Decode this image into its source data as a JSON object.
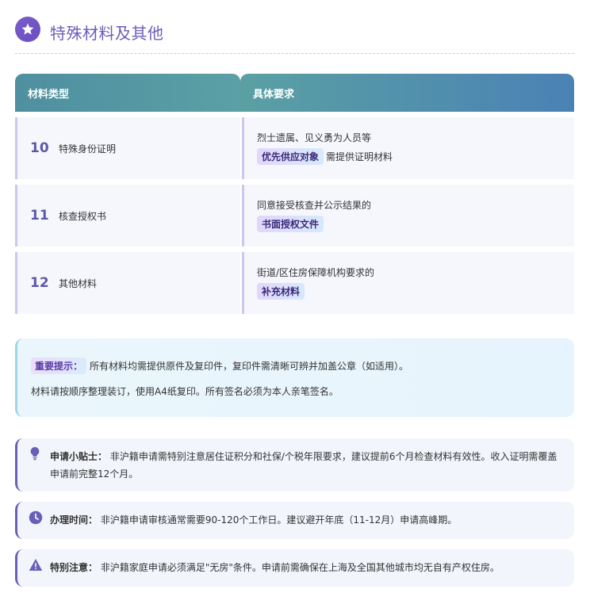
{
  "header": {
    "title": "特殊材料及其他",
    "icon": "star-icon",
    "accent": "#6a4fc0"
  },
  "table": {
    "headers": [
      "材料类型",
      "具体要求"
    ],
    "rows": [
      {
        "num": "10",
        "name": "特殊身份证明",
        "req_line1": "烈士遗属、见义勇为人员等",
        "req_highlight": "优先供应对象",
        "req_suffix": "需提供证明材料"
      },
      {
        "num": "11",
        "name": "核查授权书",
        "req_line1": "同意接受核查并公示结果的",
        "req_highlight": "书面授权文件",
        "req_suffix": ""
      },
      {
        "num": "12",
        "name": "其他材料",
        "req_line1": "街道/区住房保障机构要求的",
        "req_highlight": "补充材料",
        "req_suffix": ""
      }
    ]
  },
  "notice": {
    "tag": "重要提示：",
    "line1": "所有材料均需提供原件及复印件，复印件需清晰可辨并加盖公章（如适用）。",
    "line2": "材料请按顺序整理装订，使用A4纸复印。所有签名必须为本人亲笔签名。"
  },
  "tips": [
    {
      "icon": "lightbulb-icon",
      "label": "申请小贴士：",
      "text": "非沪籍申请需特别注意居住证积分和社保/个税年限要求，建议提前6个月检查材料有效性。收入证明需覆盖申请前完整12个月。"
    },
    {
      "icon": "clock-icon",
      "label": "办理时间：",
      "text": "非沪籍申请审核通常需要90-120个工作日。建议避开年底（11-12月）申请高峰期。"
    },
    {
      "icon": "warning-icon",
      "label": "特别注意：",
      "text": "非沪籍家庭申请必须满足\"无房\"条件。申请前需确保在上海及全国其他城市均无自有产权住房。"
    }
  ]
}
